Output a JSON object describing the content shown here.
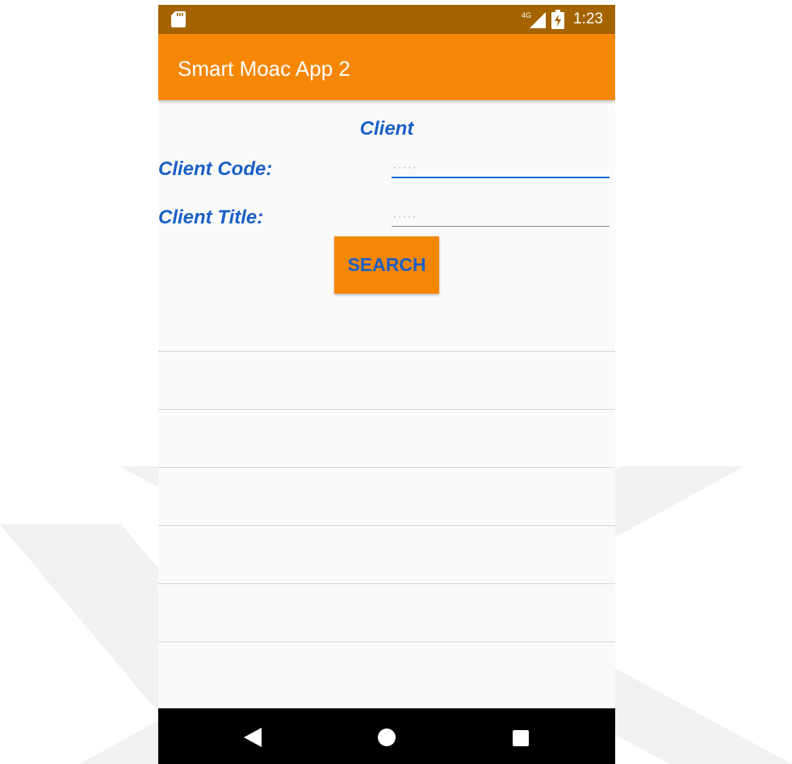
{
  "status_bar": {
    "time": "1:23",
    "network": "4G",
    "icons": [
      "sd-card-icon",
      "signal-icon",
      "battery-charging-icon"
    ]
  },
  "app_bar": {
    "title": "Smart Moac App 2"
  },
  "form": {
    "section_title": "Client",
    "client_code_label": "Client Code:",
    "client_code_placeholder": "·····",
    "client_code_value": "",
    "client_title_label": "Client Title:",
    "client_title_placeholder": "·····",
    "client_title_value": "",
    "search_label": "SEARCH"
  },
  "results": {
    "rows": [
      "",
      "",
      "",
      "",
      "",
      "",
      ""
    ]
  },
  "nav_bar": {
    "icons": [
      "back-icon",
      "home-icon",
      "recents-icon"
    ]
  },
  "colors": {
    "status_bar": "#a56300",
    "app_bar": "#f68705",
    "label_blue": "#1a5fc6",
    "nav_bar": "#000000"
  }
}
